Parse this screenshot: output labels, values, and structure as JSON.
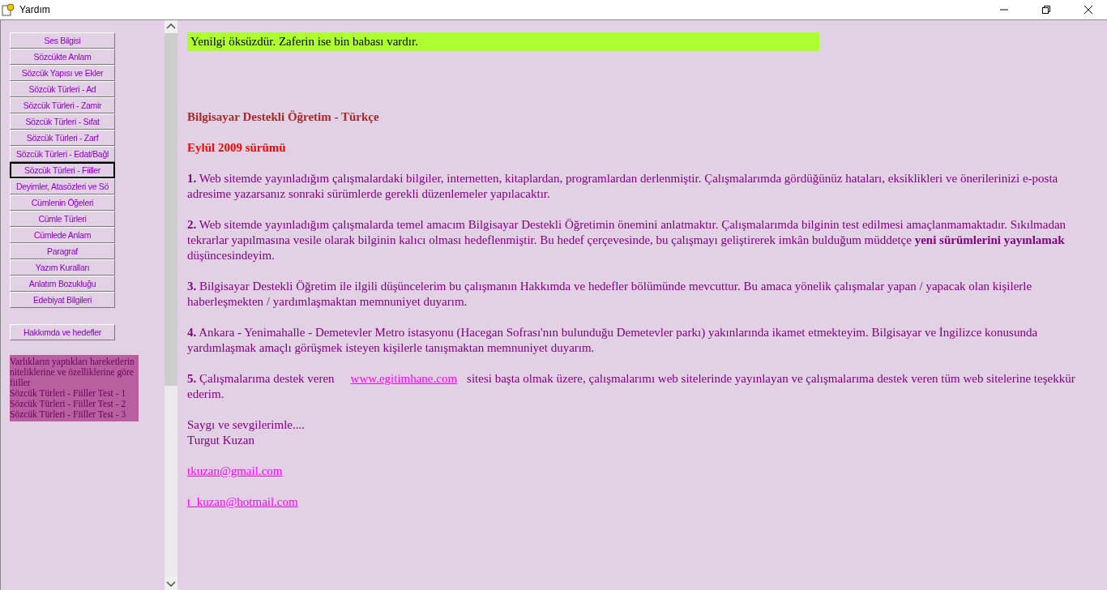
{
  "window": {
    "title": "Yardım"
  },
  "menu_buttons": [
    {
      "label": "Ses Bilgisi",
      "selected": false
    },
    {
      "label": "Sözcükte Anlam",
      "selected": false
    },
    {
      "label": "Sözcük Yapısı ve Ekler",
      "selected": false
    },
    {
      "label": "Sözcük Türleri - Ad",
      "selected": false
    },
    {
      "label": "Sözcük Türleri - Zamir",
      "selected": false
    },
    {
      "label": "Sözcük Türleri - Sıfat",
      "selected": false
    },
    {
      "label": "Sözcük Türleri - Zarf",
      "selected": false
    },
    {
      "label": "Sözcük Türleri - Edat/Bağl",
      "selected": false
    },
    {
      "label": "Sözcük Türleri - Fiiller",
      "selected": true
    },
    {
      "label": "Deyimler, Atasözleri ve Sö",
      "selected": false
    },
    {
      "label": "Cümlenin Öğeleri",
      "selected": false
    },
    {
      "label": "Cümle Türleri",
      "selected": false
    },
    {
      "label": "Cümlede Anlam",
      "selected": false
    },
    {
      "label": "Paragraf",
      "selected": false
    },
    {
      "label": "Yazım Kuralları",
      "selected": false
    },
    {
      "label": "Anlatım Bozukluğu",
      "selected": false
    },
    {
      "label": "Edebiyat Bilgileri",
      "selected": false
    }
  ],
  "about_button": "Hakkımda ve hedefler",
  "topic_list": [
    "Varlıkların yaptıkları hareketlerin niteliklerine ve özelliklerine göre fiiller",
    "Sözcük Türleri - Fiiller Test - 1",
    "Sözcük Türleri - Fiiller Test - 2",
    "Sözcük Türleri - Fiiller Test - 3"
  ],
  "quote": "Yenilgi öksüzdür. Zaferin ise bin babası vardır.",
  "heading": "Bilgisayar Destekli Öğretim - Türkçe",
  "version": "Eylül 2009 sürümü",
  "paragraphs": [
    {
      "text": "**1.** Web sitemde yayınladığım çalışmalardaki bilgiler, internetten, kitaplardan, programlardan derlenmiştir. Çalışmalarımda gördüğünüz hataları, eksiklikleri ve önerilerinizi e-posta adresime yazarsanız sonraki sürümlerde gerekli düzenlemeler yapılacaktır."
    },
    {
      "text": "**2.** Web sitemde yayınladığım çalışmalarda temel amacım Bilgisayar Destekli Öğretimin önemini anlatmaktır. Çalışmalarımda bilginin test edilmesi amaçlanmamaktadır. Sıkılmadan tekrarlar yapılmasına vesile olarak bilginin kalıcı olması hedeflenmiştir. Bu hedef çerçevesinde, bu çalışmayı geliştirerek imkân bulduğum müddetçe **yeni sürümlerini yayınlamak** düşüncesindeyim."
    },
    {
      "text": "**3.** Bilgisayar Destekli Öğretim ile ilgili düşüncelerim bu çalışmanın Hakkımda ve hedefler bölümünde mevcuttur. Bu amaca yönelik çalışmalar yapan / yapacak olan kişilerle haberleşmekten / yardımlaşmaktan memnuniyet duyarım."
    },
    {
      "text": "**4.** Ankara - Yenimahalle - Demetevler Metro istasyonu (Hacegan Sofrası'nın bulunduğu Demetevler parkı) yakınlarında ikamet etmekteyim. Bilgisayar ve İngilizce konusunda yardımlaşmak amaçlı görüşmek isteyen kişilerle tanışmaktan memnuniyet duyarım."
    },
    {
      "text": "**5.** Çalışmalarıma destek veren",
      "link": "www.egitimhane.com",
      "after": "sitesi başta olmak üzere, çalışmalarımı web sitelerinde yayınlayan ve çalışmalarıma destek veren tüm web sitelerine teşekkür ederim."
    }
  ],
  "closing": [
    "Saygı ve sevgilerimle....",
    "Turgut Kuzan"
  ],
  "emails": [
    "tkuzan@gmail.com",
    "t_kuzan@hotmail.com"
  ]
}
